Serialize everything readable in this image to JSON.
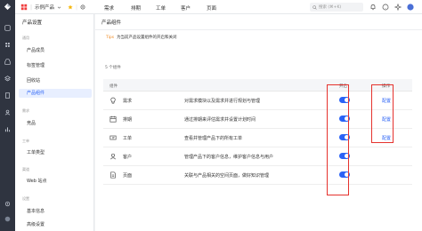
{
  "topbar": {
    "product_name": "示例产品",
    "nav": [
      "需求",
      "排期",
      "工单",
      "客户",
      "页面"
    ],
    "search_placeholder": "搜索 (⌘+K)"
  },
  "sidebar": {
    "title": "产品设置",
    "groups": [
      {
        "label": "通用",
        "items": [
          "产品成员",
          "标签管理",
          "回收站",
          "产品组件"
        ]
      },
      {
        "label": "需求",
        "items": [
          "竞品"
        ]
      },
      {
        "label": "工单",
        "items": [
          "工单类型"
        ]
      },
      {
        "label": "渠道",
        "items": [
          "Web 站点"
        ]
      },
      {
        "label": "设置",
        "items": [
          "基本信息",
          "高级设置"
        ]
      }
    ],
    "active_item": "产品组件"
  },
  "main": {
    "title": "产品组件",
    "tip_tag": "Tips",
    "tip_text": "为当前产品设置组件的开启和关闭",
    "count_text": "5 个组件",
    "columns": [
      "组件",
      "开启",
      "操作"
    ],
    "rows": [
      {
        "icon": "bulb-icon",
        "name": "需求",
        "desc": "对需求模块以及需求并进行规划与管理",
        "enabled": true,
        "action": "配置"
      },
      {
        "icon": "calendar-icon",
        "name": "排期",
        "desc": "通过排期来评估需求并设置计划时间",
        "enabled": true,
        "action": "配置"
      },
      {
        "icon": "ticket-icon",
        "name": "工单",
        "desc": "查看并管理产品下的所有工单",
        "enabled": true,
        "action": "配置"
      },
      {
        "icon": "user-icon",
        "name": "客户",
        "desc": "管理产品下的客户信息，维护客户信息与用户",
        "enabled": true,
        "action": ""
      },
      {
        "icon": "page-icon",
        "name": "页面",
        "desc": "关联与产品相关的空间页面，做好知识管理",
        "enabled": true,
        "action": ""
      }
    ]
  },
  "colors": {
    "accent": "#2b63f6",
    "highlight": "#e5322d",
    "tip": "#f08a24",
    "rail": "#2f3440"
  }
}
